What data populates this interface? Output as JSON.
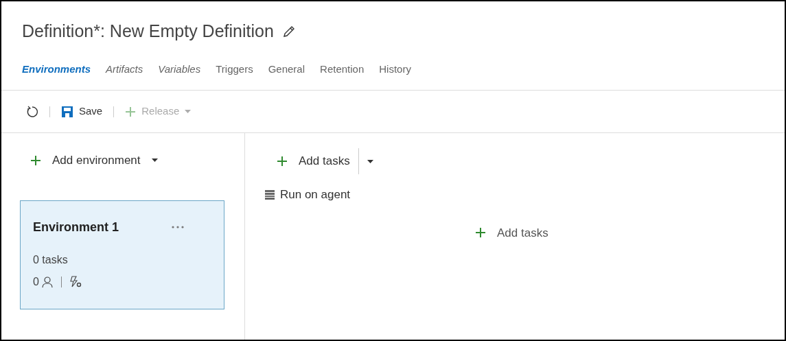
{
  "title": "Definition*: New Empty Definition",
  "tabs": [
    {
      "label": "Environments",
      "selected": true,
      "modified": true
    },
    {
      "label": "Artifacts",
      "selected": false,
      "modified": true
    },
    {
      "label": "Variables",
      "selected": false,
      "modified": true
    },
    {
      "label": "Triggers",
      "selected": false,
      "modified": false
    },
    {
      "label": "General",
      "selected": false,
      "modified": false
    },
    {
      "label": "Retention",
      "selected": false,
      "modified": false
    },
    {
      "label": "History",
      "selected": false,
      "modified": false
    }
  ],
  "toolbar": {
    "save": {
      "label": "Save",
      "disabled": false
    },
    "release": {
      "label": "Release",
      "disabled": true
    }
  },
  "environments_panel": {
    "add_button": "Add environment",
    "cards": [
      {
        "name": "Environment 1",
        "selected": true,
        "tasks": "0 tasks",
        "approvers": "0"
      }
    ]
  },
  "tasks_panel": {
    "add_button": "Add tasks",
    "phase": "Run on agent",
    "empty_add": "Add tasks"
  }
}
